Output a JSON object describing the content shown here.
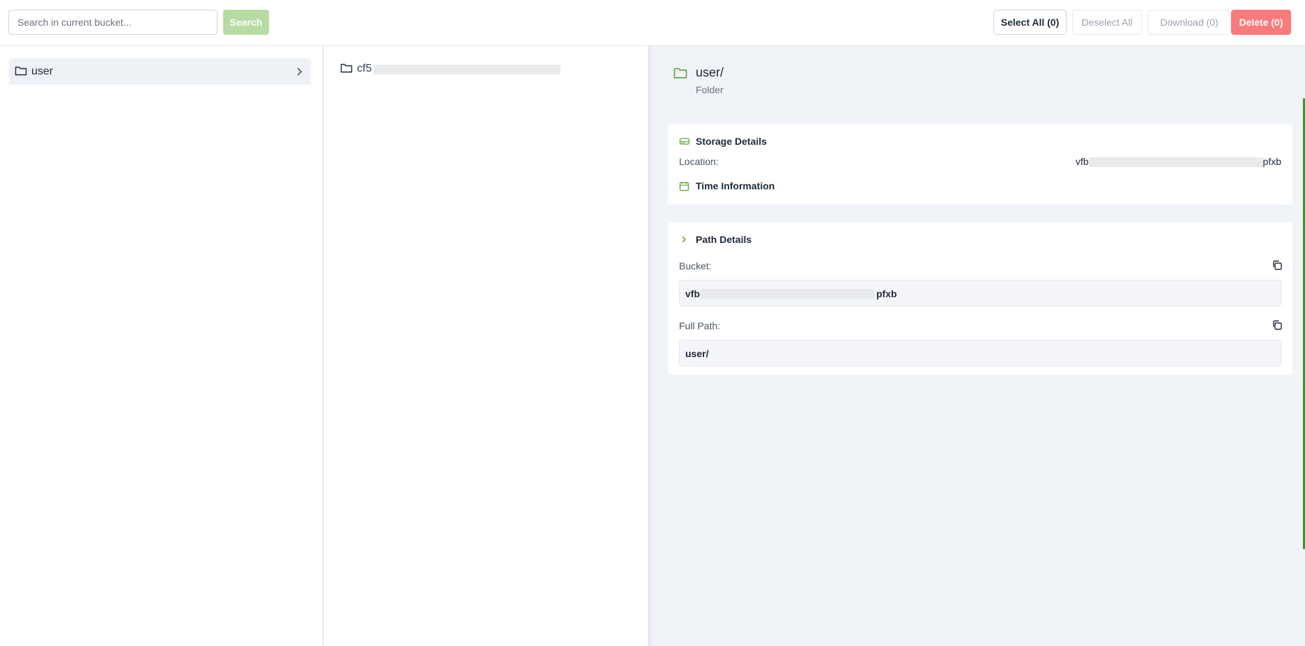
{
  "toolbar": {
    "search_placeholder": "Search in current bucket...",
    "search_label": "Search",
    "select_all_label": "Select All (0)",
    "deselect_all_label": "Deselect All",
    "download_label": "Download (0)",
    "delete_label": "Delete (0)"
  },
  "tree": {
    "items": [
      {
        "label": "user",
        "icon": "folder-icon",
        "selected": true
      }
    ]
  },
  "listing": {
    "items": [
      {
        "label": "cf5",
        "icon": "folder-icon"
      }
    ]
  },
  "detail": {
    "title": "user/",
    "type": "Folder",
    "storage": {
      "heading": "Storage Details",
      "location_label": "Location:",
      "location_prefix": "vfb",
      "location_suffix": "pfxb"
    },
    "time": {
      "heading": "Time Information"
    },
    "path": {
      "heading": "Path Details",
      "bucket_label": "Bucket:",
      "bucket_prefix": "vfb",
      "bucket_suffix": "pfxb",
      "full_path_label": "Full Path:",
      "full_path_value": "user/"
    }
  },
  "colors": {
    "accent": "#5aa33b",
    "search_button": "#b7dba3",
    "delete_button": "#f87a7a",
    "detail_background": "#f0f3f8"
  }
}
